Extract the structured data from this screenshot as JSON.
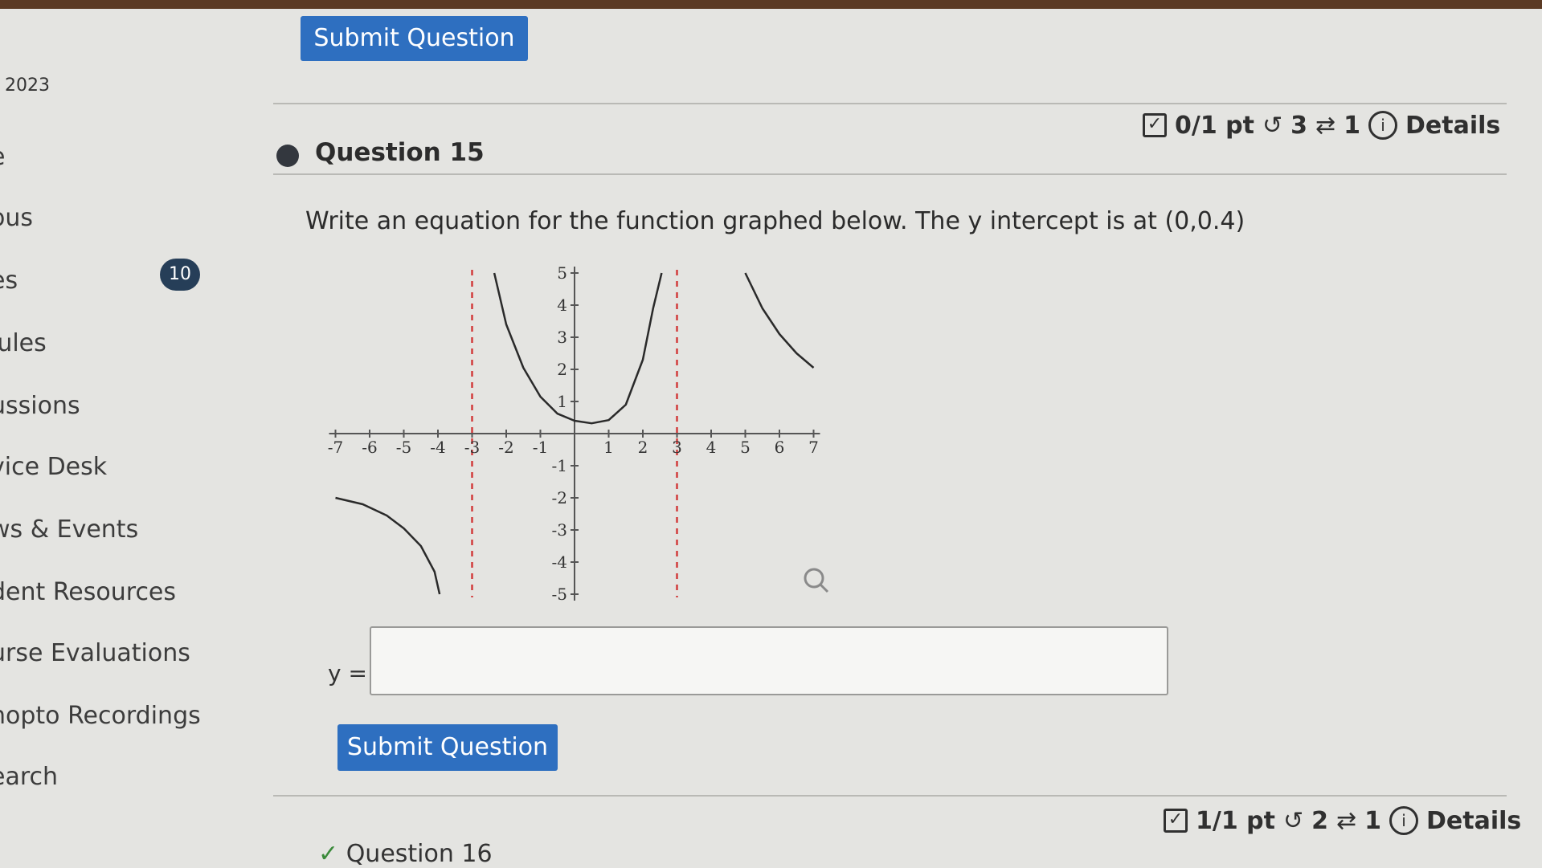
{
  "sidebar": {
    "year": "2023",
    "items": [
      {
        "label": "e"
      },
      {
        "label": "ous"
      },
      {
        "label": "es",
        "badge": "10"
      },
      {
        "label": "lules"
      },
      {
        "label": "ussions"
      },
      {
        "label": "vice Desk"
      },
      {
        "label": "ws & Events"
      },
      {
        "label": "dent Resources"
      },
      {
        "label": "urse Evaluations"
      },
      {
        "label": "nopto Recordings"
      },
      {
        "label": "earch"
      }
    ]
  },
  "top_button": {
    "label": "Submit Question"
  },
  "question15": {
    "title": "Question 15",
    "score": "0/1 pt",
    "retries": "3",
    "attempts": "1",
    "details": "Details",
    "prompt": "Write an equation for the function graphed below. The y intercept is at (0,0.4)",
    "answer_label": "y =",
    "answer_value": "",
    "submit": "Submit Question"
  },
  "question16": {
    "title": "Question 16",
    "score": "1/1 pt",
    "retries": "2",
    "attempts": "1",
    "details": "Details"
  },
  "colors": {
    "button": "#2e6fc0",
    "badge": "#263e58",
    "asymptote": "#d23c3c",
    "curve": "#2a2a2a"
  },
  "icons": [
    "checkbox-icon",
    "retry-icon",
    "attempts-icon",
    "info-icon",
    "magnify-icon",
    "checkmark-icon"
  ],
  "chart_data": {
    "type": "line",
    "x_ticks": [
      "-7",
      "-6",
      "-5",
      "-4",
      "-3",
      "-2",
      "-1",
      "1",
      "2",
      "3",
      "4",
      "5",
      "6",
      "7"
    ],
    "y_ticks": [
      "5",
      "4",
      "3",
      "2",
      "1",
      "-1",
      "-2",
      "-3",
      "-4",
      "-5"
    ],
    "xlim": [
      -7,
      7
    ],
    "ylim": [
      -5,
      5
    ],
    "asymptotes_x": [
      -3,
      3
    ],
    "grid": false,
    "y_intercept": [
      0,
      0.4
    ],
    "series": [
      {
        "x": [
          -2.35,
          -2,
          -1.5,
          -1,
          -0.5,
          0,
          0.5,
          1,
          1.5,
          2,
          2.3,
          2.55
        ],
        "y": [
          5,
          3.4,
          2.05,
          1.15,
          0.62,
          0.4,
          0.32,
          0.42,
          0.9,
          2.3,
          3.9,
          5
        ]
      },
      {
        "x": [
          5,
          5.5,
          6,
          6.5,
          7
        ],
        "y": [
          5,
          3.9,
          3.1,
          2.5,
          2.05
        ]
      },
      {
        "x": [
          -7,
          -6.2,
          -5.5,
          -5,
          -4.5,
          -4.1,
          -3.95
        ],
        "y": [
          -2,
          -2.2,
          -2.55,
          -2.95,
          -3.5,
          -4.3,
          -5
        ]
      }
    ]
  }
}
